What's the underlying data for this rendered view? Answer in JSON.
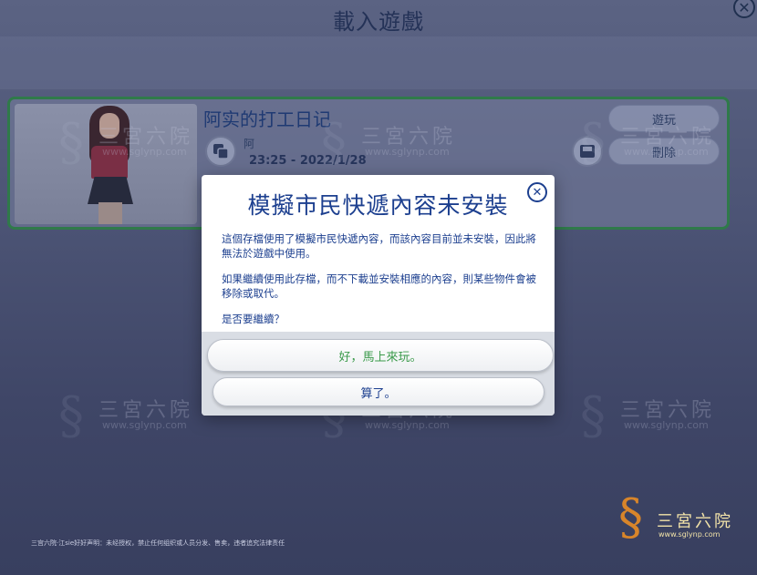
{
  "screen": {
    "title": "載入遊戲",
    "close_glyph": "✕"
  },
  "save_card": {
    "name": "阿实的打工日记",
    "household": "阿",
    "timestamp": "23:25 - 2022/1/28",
    "play_button": "遊玩",
    "delete_button": "刪除"
  },
  "dialog": {
    "title": "模擬市民快遞內容未安裝",
    "close_glyph": "✕",
    "paragraph1": "這個存檔使用了模擬市民快遞內容，而該內容目前並未安裝，因此將無法於遊戲中使用。",
    "paragraph2": "如果繼續使用此存檔，而不下載並安裝相應的內容，則某些物件會被移除或取代。",
    "question": "是否要繼續？",
    "confirm_label": "好，馬上來玩。",
    "cancel_label": "算了。"
  },
  "watermark": {
    "name": "三宮六院",
    "url": "www.sglynp.com"
  },
  "footer_note": "三宫六院·江sie好好声明：未经授权，禁止任何组织或人员分发、售卖，违者追究法律责任",
  "colors": {
    "accent_blue": "#1c3f8f",
    "confirm_green": "#3a9a4a",
    "card_border": "#2f7a4a"
  }
}
